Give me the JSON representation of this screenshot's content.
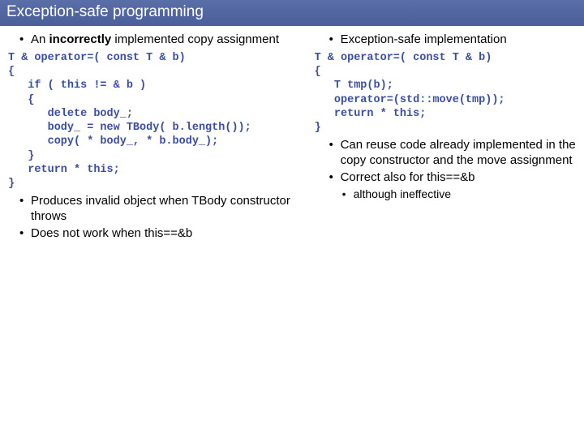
{
  "title": "Exception-safe programming",
  "left": {
    "heading_prefix": "An ",
    "heading_bold": "incorrectly",
    "heading_suffix": " implemented copy assignment",
    "code": "T & operator=( const T & b)\n{\n   if ( this != & b )\n   {\n      delete body_;\n      body_ = new TBody( b.length());\n      copy( * body_, * b.body_);\n   }\n   return * this;\n}",
    "note1": "Produces invalid object when TBody constructor throws",
    "note2": "Does not work when this==&b"
  },
  "right": {
    "heading": "Exception-safe implementation",
    "code": "T & operator=( const T & b)\n{\n   T tmp(b);\n   operator=(std::move(tmp));\n   return * this;\n}",
    "note1": "Can reuse code already implemented in the copy constructor and the move assignment",
    "note2": "Correct also for this==&b",
    "subnote": "although ineffective"
  }
}
